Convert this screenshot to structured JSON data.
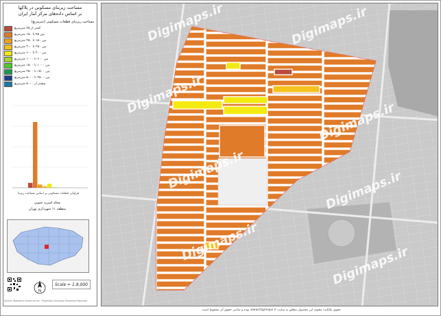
{
  "header": {
    "title_line1": "مساحت زیربنای مسکونی در پلاکها",
    "title_line2": "بر اساس داده‌های مرکز آمار ایران"
  },
  "legend": {
    "title": "مساحت زیربنای قطعات مسکونی (مترمربع)",
    "items": [
      {
        "label": "کمتر از ۷۵ مترمربع",
        "color": "#b94a3c"
      },
      {
        "label": "بین ۷۵ تا ۱۵۰ مترمربع",
        "color": "#e07b2a"
      },
      {
        "label": "بین ۱۵۰ تا ۲۵۰ مترمربع",
        "color": "#f0a020"
      },
      {
        "label": "بین ۲۵۰ تا ۴۰۰ مترمربع",
        "color": "#f4c21c"
      },
      {
        "label": "بین ۴۰۰ تا ۶۰۰ مترمربع",
        "color": "#f3ea10"
      },
      {
        "label": "بین ۶۰۰ تا ۱۰۰۰ مترمربع",
        "color": "#a3d82a"
      },
      {
        "label": "بین ۱۰۰۰ تا ۱۵۰۰ مترمربع",
        "color": "#4cc92e"
      },
      {
        "label": "بین ۱۵۰۰ تا ۲۵۰۰ مترمربع",
        "color": "#1e9a4e"
      },
      {
        "label": "بین ۲۵۰۰ تا ۵۰۰۰ مترمربع",
        "color": "#1c3f8c"
      },
      {
        "label": "بیشتر از ۵۰۰۰ مترمربع",
        "color": "#1b7aa8"
      }
    ]
  },
  "chart_data": {
    "type": "bar",
    "categories": [
      "<75",
      "75-150",
      "150-250",
      "250-400",
      "400-600",
      "600-1000",
      "1000-1500",
      "1500-2500",
      "2500-5000",
      ">5000"
    ],
    "values": [
      6,
      80,
      4,
      2,
      5,
      0.5,
      0,
      0,
      0,
      0
    ],
    "colors": [
      "#b94a3c",
      "#e07b2a",
      "#f0a020",
      "#f4c21c",
      "#f3ea10",
      "#a3d82a",
      "#4cc92e",
      "#1e9a4e",
      "#1c3f8c",
      "#1b7aa8"
    ],
    "xlabel": "",
    "ylabel": "",
    "ylim": [
      0,
      100
    ],
    "grid": true,
    "caption": "فراوانی قطعات مسکونی بر اساس مساحت زیربنا"
  },
  "location": {
    "line1": "محله امیریه جنوبی",
    "line2": "منطقه ۱۱ شهرداری تهران"
  },
  "scale_text": "Scale = 1:8,000",
  "north_label": "N",
  "watermark": "Digimaps.ir",
  "footer_text": "حقوق مالکیت معنوی این محصول متعلق به سایت www.Digimaps.ir بوده و تمامی حقوق آن محفوظ است.",
  "credit_text": "Source: Statistical Centre of Iran - Projection: Universal Transverse Mercator"
}
